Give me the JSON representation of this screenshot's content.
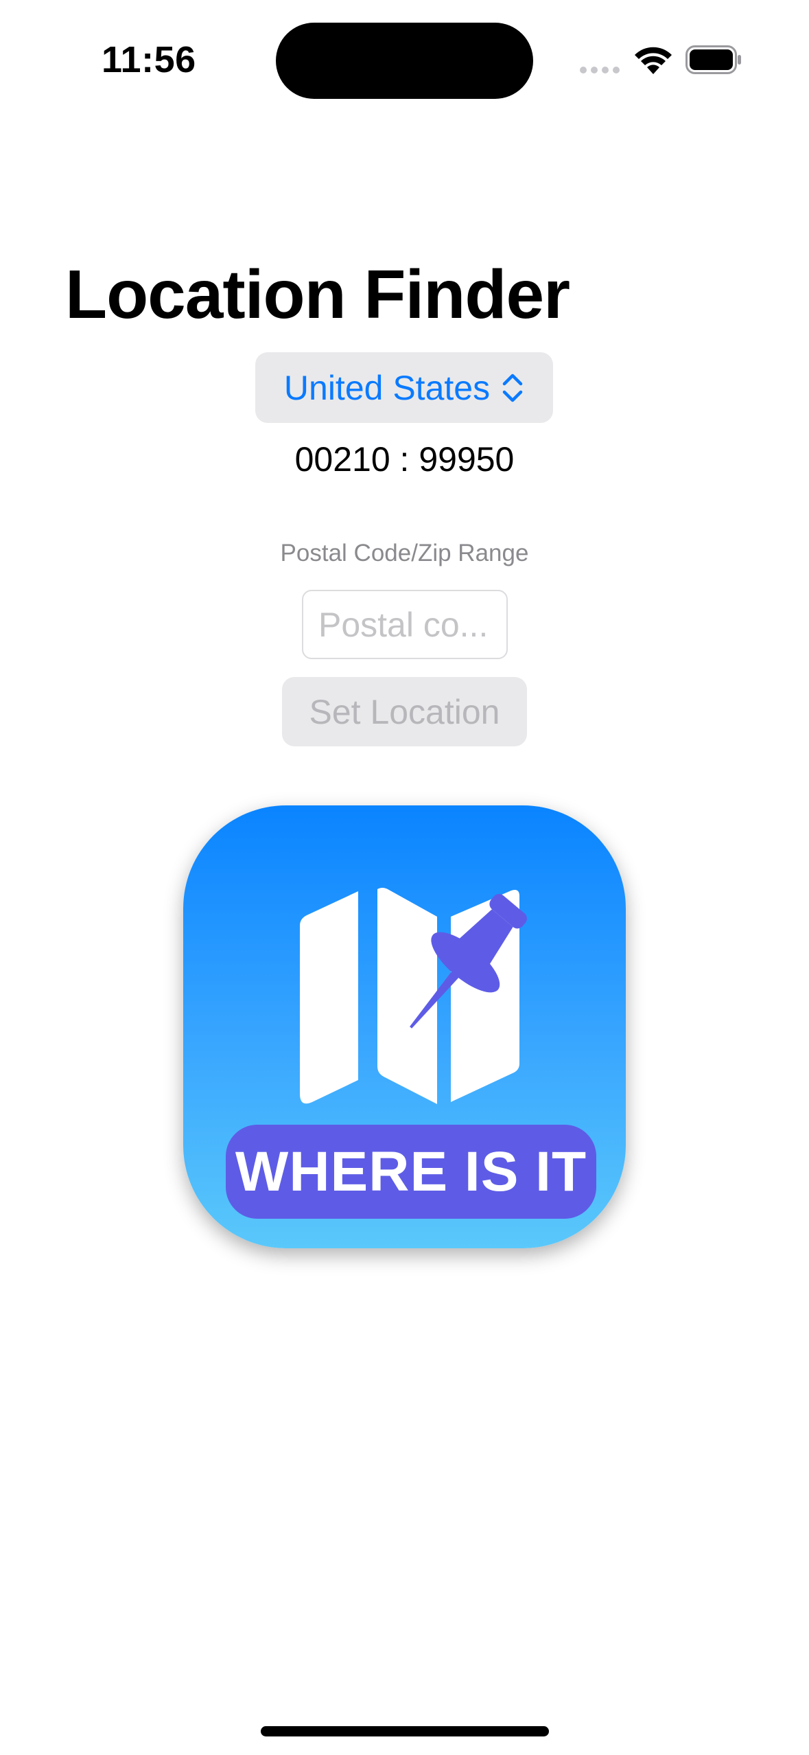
{
  "status_bar": {
    "time": "11:56",
    "icons": [
      "signal-dots-icon",
      "wifi-icon",
      "battery-icon"
    ]
  },
  "title": "Location Finder",
  "country_picker": {
    "selected": "United States",
    "icon": "chevron-updown-icon"
  },
  "zip_range": "00210 : 99950",
  "postal_field": {
    "label": "Postal Code/Zip Range",
    "placeholder": "Postal co...",
    "value": ""
  },
  "set_location_button": {
    "label": "Set Location",
    "enabled": false
  },
  "app_icon": {
    "banner_text": "WHERE IS IT",
    "icon": "map-pin-icon"
  },
  "colors": {
    "accent": "#0a7aff",
    "banner": "#5e5ce6",
    "icon_gradient_top": "#0a84ff",
    "icon_gradient_bottom": "#5ac8fa"
  }
}
